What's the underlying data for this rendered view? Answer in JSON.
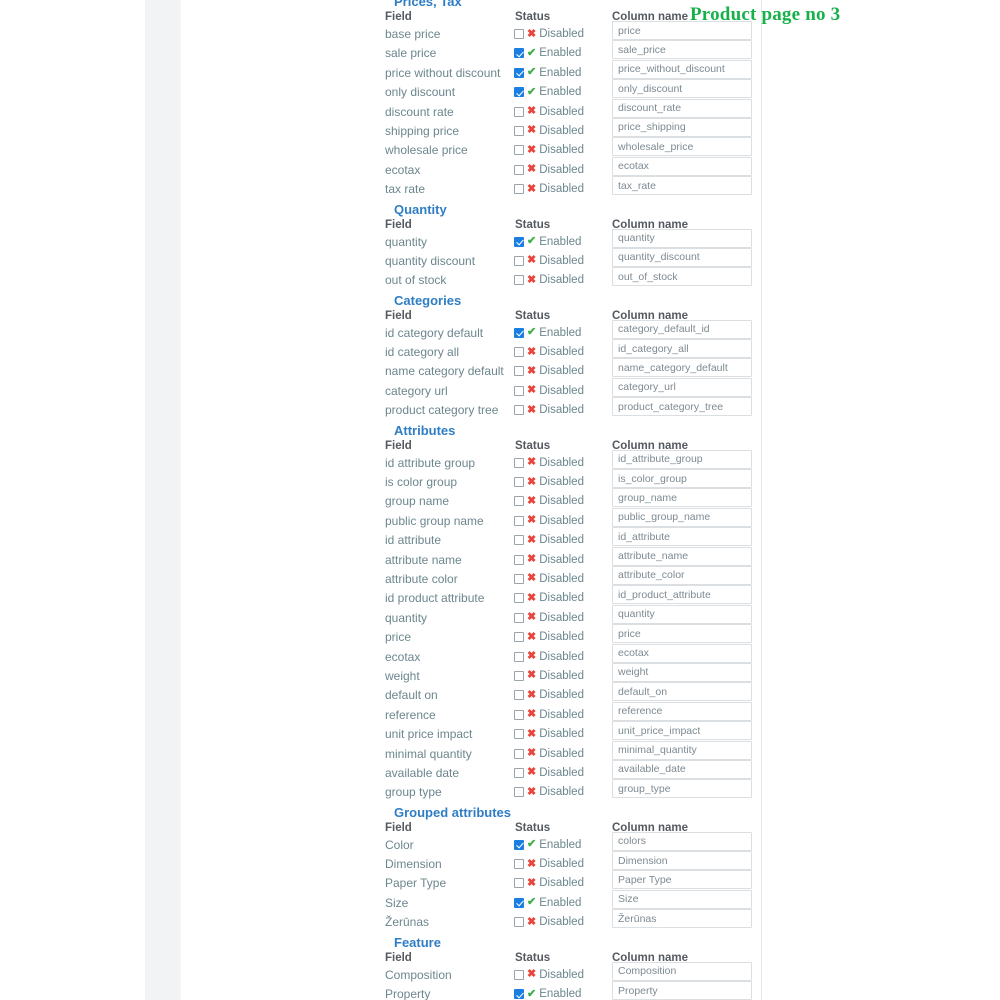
{
  "page": {
    "title": "Product page no 3",
    "title_color": "#17b14b",
    "heading_color": "#2f7ec5",
    "checkbox_on_color": "#1a7fe0",
    "enabled_mark_color": "#3fae49",
    "disabled_mark_color": "#e8453c"
  },
  "labels": {
    "field": "Field",
    "status": "Status",
    "column_name": "Column name",
    "enabled": "Enabled",
    "disabled": "Disabled",
    "check_icon": "check-icon",
    "cross_icon": "cross-icon"
  },
  "sections": [
    {
      "id": "prices-tax",
      "title": "Prices, Tax",
      "rows": [
        {
          "field": "base price",
          "enabled": false,
          "column": "price"
        },
        {
          "field": "sale price",
          "enabled": true,
          "column": "sale_price"
        },
        {
          "field": "price without discount",
          "enabled": true,
          "column": "price_without_discount"
        },
        {
          "field": "only discount",
          "enabled": true,
          "column": "only_discount"
        },
        {
          "field": "discount rate",
          "enabled": false,
          "column": "discount_rate"
        },
        {
          "field": "shipping price",
          "enabled": false,
          "column": "price_shipping"
        },
        {
          "field": "wholesale price",
          "enabled": false,
          "column": "wholesale_price"
        },
        {
          "field": "ecotax",
          "enabled": false,
          "column": "ecotax"
        },
        {
          "field": "tax rate",
          "enabled": false,
          "column": "tax_rate"
        }
      ]
    },
    {
      "id": "quantity",
      "title": "Quantity",
      "rows": [
        {
          "field": "quantity",
          "enabled": true,
          "column": "quantity"
        },
        {
          "field": "quantity discount",
          "enabled": false,
          "column": "quantity_discount"
        },
        {
          "field": "out of stock",
          "enabled": false,
          "column": "out_of_stock"
        }
      ]
    },
    {
      "id": "categories",
      "title": "Categories",
      "rows": [
        {
          "field": "id category default",
          "enabled": true,
          "column": "category_default_id"
        },
        {
          "field": "id category all",
          "enabled": false,
          "column": "id_category_all"
        },
        {
          "field": "name category default",
          "enabled": false,
          "column": "name_category_default"
        },
        {
          "field": "category url",
          "enabled": false,
          "column": "category_url"
        },
        {
          "field": "product category tree",
          "enabled": false,
          "column": "product_category_tree"
        }
      ]
    },
    {
      "id": "attributes",
      "title": "Attributes",
      "rows": [
        {
          "field": "id attribute group",
          "enabled": false,
          "column": "id_attribute_group"
        },
        {
          "field": "is color group",
          "enabled": false,
          "column": "is_color_group"
        },
        {
          "field": "group name",
          "enabled": false,
          "column": "group_name"
        },
        {
          "field": "public group name",
          "enabled": false,
          "column": "public_group_name"
        },
        {
          "field": "id attribute",
          "enabled": false,
          "column": "id_attribute"
        },
        {
          "field": "attribute name",
          "enabled": false,
          "column": "attribute_name"
        },
        {
          "field": "attribute color",
          "enabled": false,
          "column": "attribute_color"
        },
        {
          "field": "id product attribute",
          "enabled": false,
          "column": "id_product_attribute"
        },
        {
          "field": "quantity",
          "enabled": false,
          "column": "quantity"
        },
        {
          "field": "price",
          "enabled": false,
          "column": "price"
        },
        {
          "field": "ecotax",
          "enabled": false,
          "column": "ecotax"
        },
        {
          "field": "weight",
          "enabled": false,
          "column": "weight"
        },
        {
          "field": "default on",
          "enabled": false,
          "column": "default_on"
        },
        {
          "field": "reference",
          "enabled": false,
          "column": "reference"
        },
        {
          "field": "unit price impact",
          "enabled": false,
          "column": "unit_price_impact"
        },
        {
          "field": "minimal quantity",
          "enabled": false,
          "column": "minimal_quantity"
        },
        {
          "field": "available date",
          "enabled": false,
          "column": "available_date"
        },
        {
          "field": "group type",
          "enabled": false,
          "column": "group_type"
        }
      ]
    },
    {
      "id": "grouped-attributes",
      "title": "Grouped attributes",
      "rows": [
        {
          "field": "Color",
          "enabled": true,
          "column": "colors"
        },
        {
          "field": "Dimension",
          "enabled": false,
          "column": "Dimension"
        },
        {
          "field": "Paper Type",
          "enabled": false,
          "column": "Paper Type"
        },
        {
          "field": "Size",
          "enabled": true,
          "column": "Size"
        },
        {
          "field": "Žerūnas",
          "enabled": false,
          "column": "Žerūnas"
        }
      ]
    },
    {
      "id": "feature",
      "title": "Feature",
      "rows": [
        {
          "field": "Composition",
          "enabled": false,
          "column": "Composition"
        },
        {
          "field": "Property",
          "enabled": true,
          "column": "Property"
        }
      ]
    }
  ]
}
